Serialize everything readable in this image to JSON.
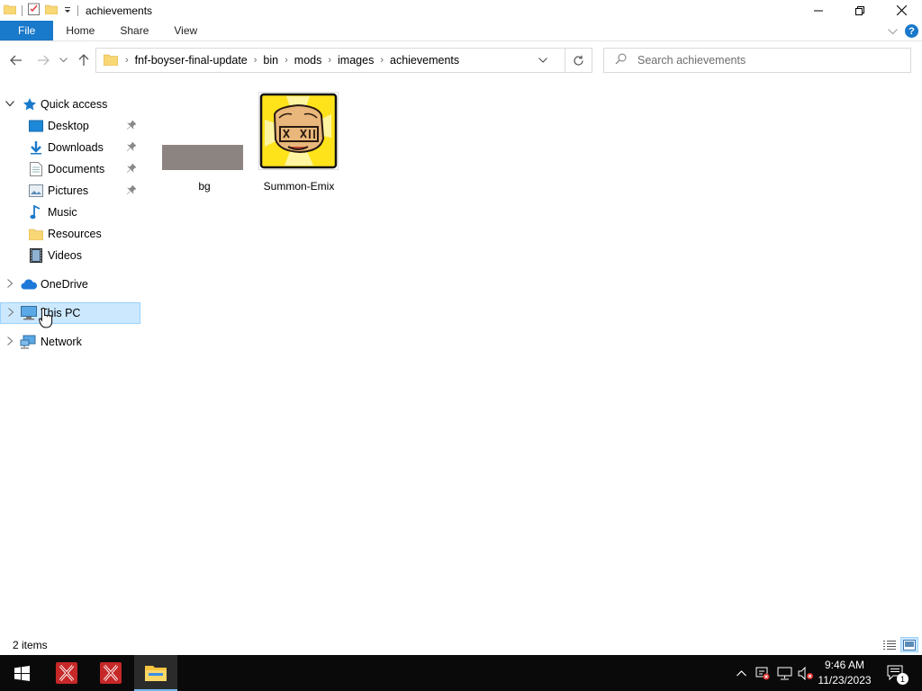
{
  "window": {
    "title": "achievements",
    "quick_access_toolbar": [
      "folder-icon",
      "properties-icon",
      "new-folder-icon",
      "customize-dropdown-icon"
    ]
  },
  "ribbon": {
    "tabs": [
      "File",
      "Home",
      "Share",
      "View"
    ]
  },
  "address": {
    "breadcrumbs": [
      "fnf-boyser-final-update",
      "bin",
      "mods",
      "images",
      "achievements"
    ]
  },
  "search": {
    "placeholder": "Search achievements"
  },
  "nav": {
    "quick_access": "Quick access",
    "items": [
      {
        "label": "Desktop",
        "icon": "desktop-icon",
        "pinned": true
      },
      {
        "label": "Downloads",
        "icon": "downloads-icon",
        "pinned": true
      },
      {
        "label": "Documents",
        "icon": "documents-icon",
        "pinned": true
      },
      {
        "label": "Pictures",
        "icon": "pictures-icon",
        "pinned": true
      },
      {
        "label": "Music",
        "icon": "music-icon",
        "pinned": false
      },
      {
        "label": "Resources",
        "icon": "folder-icon",
        "pinned": false
      },
      {
        "label": "Videos",
        "icon": "videos-icon",
        "pinned": false
      }
    ],
    "onedrive": "OneDrive",
    "this_pc": "This PC",
    "network": "Network"
  },
  "files": [
    {
      "name": "bg",
      "type": "image"
    },
    {
      "name": "Summon-Emix",
      "type": "image"
    }
  ],
  "status": {
    "item_count": "2 items"
  },
  "taskbar": {
    "time": "9:46 AM",
    "date": "11/23/2023",
    "notification_count": "1"
  },
  "colors": {
    "accent": "#1979ca",
    "selection": "#cce8ff",
    "selection_border": "#99d1ff",
    "taskbar": "#0a0a0a"
  }
}
